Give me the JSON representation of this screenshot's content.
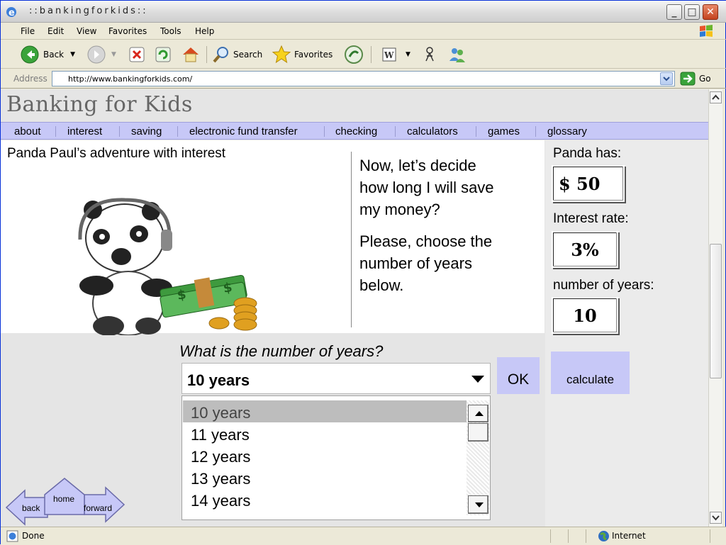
{
  "window": {
    "title": "::bankingforkids::"
  },
  "menu": [
    "File",
    "Edit",
    "View",
    "Favorites",
    "Tools",
    "Help"
  ],
  "toolbar": {
    "back_label": "Back",
    "search_label": "Search",
    "favorites_label": "Favorites"
  },
  "address": {
    "label": "Address",
    "url": "http://www.bankingforkids.com/",
    "go_label": "Go"
  },
  "site": {
    "logo_text": "Banking for Kids",
    "nav": [
      "about",
      "interest",
      "saving",
      "electronic fund transfer",
      "checking",
      "calculators",
      "games",
      "glossary"
    ]
  },
  "story": {
    "title": "Panda Paul’s adventure with interest",
    "text1": "Now, let’s decide how long I will save my money?",
    "text2": "Please, choose the number of years below."
  },
  "info": {
    "panda_has_label": "Panda has:",
    "panda_has_value": "$ 50",
    "rate_label": "Interest rate:",
    "rate_value": "3%",
    "years_label": "number of years:",
    "years_value": "10",
    "calculate_label": "calculate"
  },
  "question": {
    "prompt": "What is the number of years?",
    "selected": "10 years",
    "ok_label": "OK",
    "options": [
      "10 years",
      "11 years",
      "12 years",
      "13 years",
      "14 years"
    ]
  },
  "pagenav": {
    "back": "back",
    "home": "home",
    "forward": "forward"
  },
  "status": {
    "text": "Done",
    "zone": "Internet"
  },
  "colors": {
    "nav_bg": "#c7c8f7",
    "page_bg": "#e5e5e5"
  }
}
